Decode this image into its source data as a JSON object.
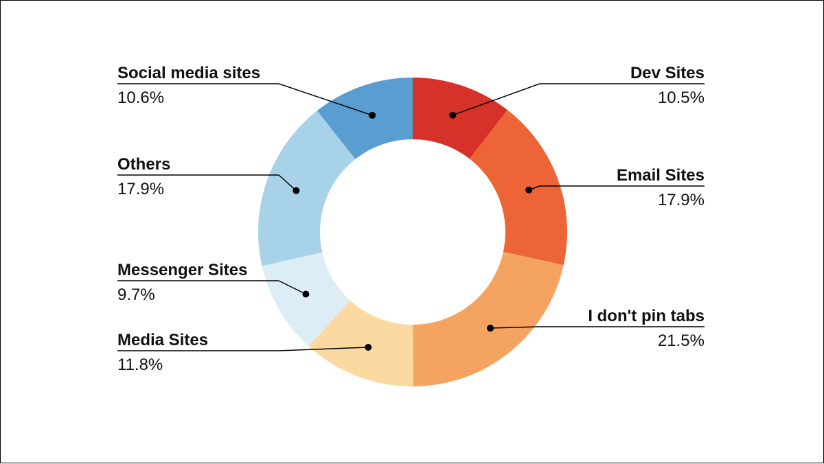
{
  "chart_data": {
    "type": "pie",
    "title": "",
    "series": [
      {
        "name": "Dev Sites",
        "value": 10.5,
        "percent_label": "10.5%",
        "color": "#d6322a"
      },
      {
        "name": "Email Sites",
        "value": 17.9,
        "percent_label": "17.9%",
        "color": "#ed6436"
      },
      {
        "name": "I don't pin tabs",
        "value": 21.5,
        "percent_label": "21.5%",
        "color": "#f4a460"
      },
      {
        "name": "Media Sites",
        "value": 11.8,
        "percent_label": "11.8%",
        "color": "#fcd9a0"
      },
      {
        "name": "Messenger Sites",
        "value": 9.7,
        "percent_label": "9.7%",
        "color": "#dcedf5"
      },
      {
        "name": "Others",
        "value": 17.9,
        "percent_label": "17.9%",
        "color": "#a8d2e8"
      },
      {
        "name": "Social media sites",
        "value": 10.6,
        "percent_label": "10.6%",
        "color": "#5a9dd0"
      }
    ],
    "donut": true,
    "legend": "callouts"
  }
}
